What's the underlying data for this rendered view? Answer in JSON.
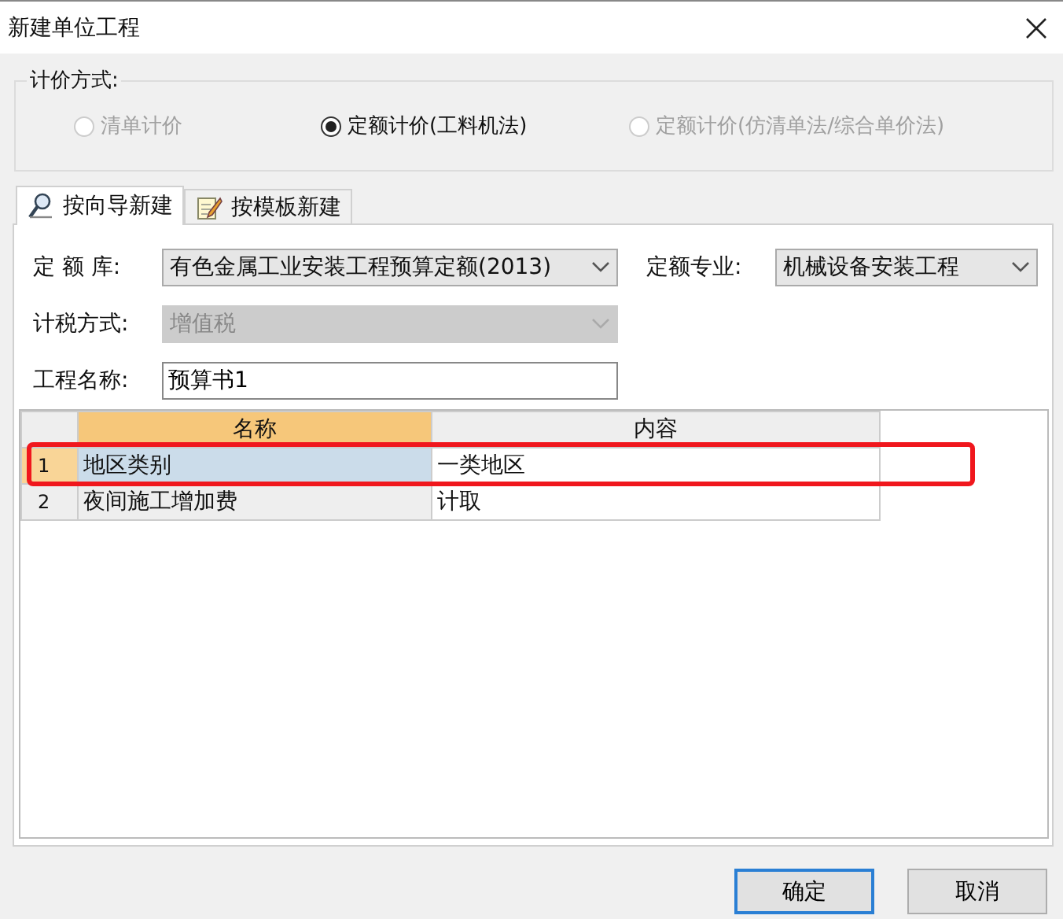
{
  "window": {
    "title": "新建单位工程"
  },
  "pricing": {
    "label": "计价方式:",
    "options": [
      {
        "label": "清单计价",
        "selected": false,
        "disabled": true
      },
      {
        "label": "定额计价(工料机法)",
        "selected": true,
        "disabled": false
      },
      {
        "label": "定额计价(仿清单法/综合单价法)",
        "selected": false,
        "disabled": true
      }
    ]
  },
  "tabs": [
    {
      "label": "按向导新建",
      "selected": true,
      "kind": "wizard"
    },
    {
      "label": "按模板新建",
      "selected": false,
      "kind": "template"
    }
  ],
  "form": {
    "library": {
      "label": "定 额 库:",
      "value": "有色金属工业安装工程预算定额(2013)",
      "disabled": false
    },
    "specialty": {
      "label": "定额专业:",
      "value": "机械设备安装工程",
      "disabled": false
    },
    "tax": {
      "label": "计税方式:",
      "value": "增值税",
      "disabled": true
    },
    "name": {
      "label": "工程名称:",
      "value": "预算书1"
    }
  },
  "grid": {
    "columns": [
      {
        "label": "名称",
        "selected": true
      },
      {
        "label": "内容",
        "selected": false
      }
    ],
    "rows": [
      {
        "index": "1",
        "name": "地区类别",
        "value": "一类地区",
        "selected": true,
        "marked": true
      },
      {
        "index": "2",
        "name": "夜间施工增加费",
        "value": "计取",
        "selected": false
      }
    ]
  },
  "buttons": [
    {
      "label": "确定",
      "default": true
    },
    {
      "label": "取消",
      "default": false
    }
  ]
}
